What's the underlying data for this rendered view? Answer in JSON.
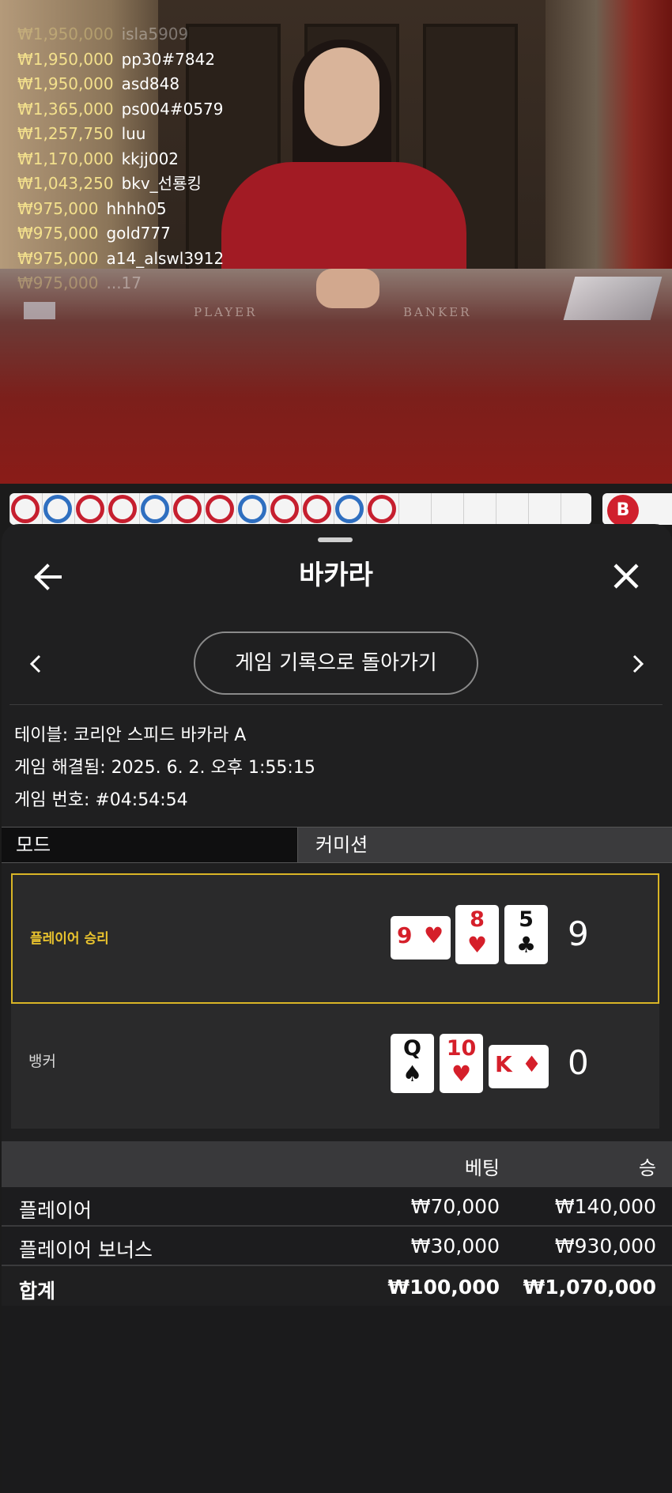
{
  "live_feed": [
    {
      "amount": "₩1,950,000",
      "user": "isla5909"
    },
    {
      "amount": "₩1,950,000",
      "user": "pp30#7842"
    },
    {
      "amount": "₩1,950,000",
      "user": "asd848"
    },
    {
      "amount": "₩1,365,000",
      "user": "ps004#0579"
    },
    {
      "amount": "₩1,257,750",
      "user": "luu"
    },
    {
      "amount": "₩1,170,000",
      "user": "kkjj002"
    },
    {
      "amount": "₩1,043,250",
      "user": "bkv_선룡킹"
    },
    {
      "amount": "₩975,000",
      "user": "hhhh05"
    },
    {
      "amount": "₩975,000",
      "user": "gold777"
    },
    {
      "amount": "₩975,000",
      "user": "a14_alswl3912"
    },
    {
      "amount": "₩975,000",
      "user": "...17"
    }
  ],
  "table_felt": {
    "player": "PLAYER",
    "banker": "BANKER"
  },
  "roadmap": {
    "badge": "B",
    "results": [
      "P",
      "B",
      "P",
      "P",
      "B",
      "P",
      "P",
      "B",
      "P",
      "P",
      "B",
      "P"
    ]
  },
  "sheet": {
    "title": "바카라",
    "back_icon": "arrow-left-icon",
    "close_icon": "close-icon",
    "history_button": "게임 기록으로 돌아가기",
    "table_line": "테이블: 코리안 스피드 바카라 A",
    "resolved_line": "게임 해결됨: 2025. 6. 2. 오후 1:55:15",
    "game_number_line": "게임 번호: #04:54:54",
    "tabs": {
      "mode": "모드",
      "commission": "커미션"
    }
  },
  "result": {
    "player": {
      "label": "플레이어 승리",
      "score": "9",
      "cards": [
        {
          "rank": "9",
          "suit": "♥",
          "color": "red",
          "sideways": true
        },
        {
          "rank": "8",
          "suit": "♥",
          "color": "red",
          "sideways": false
        },
        {
          "rank": "5",
          "suit": "♣",
          "color": "black",
          "sideways": false
        }
      ]
    },
    "banker": {
      "label": "뱅커",
      "score": "0",
      "cards": [
        {
          "rank": "Q",
          "suit": "♠",
          "color": "black",
          "sideways": false
        },
        {
          "rank": "10",
          "suit": "♥",
          "color": "red",
          "sideways": false
        },
        {
          "rank": "K",
          "suit": "♦",
          "color": "red",
          "sideways": true
        }
      ]
    }
  },
  "bets": {
    "headers": {
      "bet": "베팅",
      "win": "승"
    },
    "rows": [
      {
        "name": "플레이어",
        "bet": "₩70,000",
        "win": "₩140,000"
      },
      {
        "name": "플레이어 보너스",
        "bet": "₩30,000",
        "win": "₩930,000"
      }
    ],
    "total": {
      "name": "합계",
      "bet": "₩100,000",
      "win": "₩1,070,000"
    }
  },
  "colors": {
    "accent_gold": "#d9b526",
    "player_red": "#c61f2f",
    "banker_blue": "#2f6fc0"
  }
}
